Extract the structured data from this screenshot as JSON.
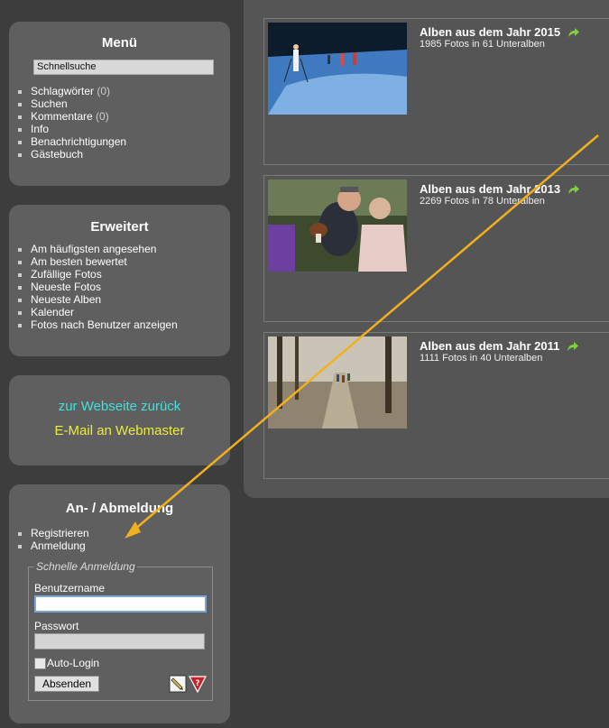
{
  "menu": {
    "title": "Menü",
    "quicksearch": "Schnellsuche",
    "items": [
      {
        "label": "Schlagwörter",
        "count": "(0)"
      },
      {
        "label": "Suchen",
        "count": ""
      },
      {
        "label": "Kommentare",
        "count": "(0)"
      },
      {
        "label": "Info",
        "count": ""
      },
      {
        "label": "Benachrichtigungen",
        "count": ""
      },
      {
        "label": "Gästebuch",
        "count": ""
      }
    ]
  },
  "erweitert": {
    "title": "Erweitert",
    "items": [
      "Am häufigsten angesehen",
      "Am besten bewertet",
      "Zufällige Fotos",
      "Neueste Fotos",
      "Neueste Alben",
      "Kalender",
      "Fotos nach Benutzer anzeigen"
    ]
  },
  "links": {
    "website": "zur Webseite zurück",
    "email": "E-Mail an Webmaster",
    "website_color": "#3ce3e0",
    "email_color": "#ecec3c"
  },
  "login": {
    "title": "An- / Abmeldung",
    "items": [
      "Registrieren",
      "Anmeldung"
    ],
    "legend": "Schnelle Anmeldung",
    "username_label": "Benutzername",
    "username_value": "",
    "password_label": "Passwort",
    "password_value": "",
    "autologin_label": "Auto-Login",
    "submit_label": "Absenden",
    "icons": [
      "pencil-icon",
      "help-icon"
    ]
  },
  "albums": [
    {
      "title": "Alben aus dem Jahr 2015",
      "subtitle": "1985 Fotos in 61 Unteralben",
      "thumb": "snow-hikers"
    },
    {
      "title": "Alben aus dem Jahr 2013",
      "subtitle": "2269 Fotos in 78 Unteralben",
      "thumb": "mushroom-couple"
    },
    {
      "title": "Alben aus dem Jahr 2011",
      "subtitle": "1111 Fotos in 40 Unteralben",
      "thumb": "forest-path"
    }
  ],
  "annotation": {
    "arrow_color": "#f2b01e"
  },
  "colors": {
    "page_bg": "#3d3d3d",
    "panel_bg": "#5f5f5f",
    "content_bg": "#555555",
    "green_arrow": "#7cd33a"
  }
}
